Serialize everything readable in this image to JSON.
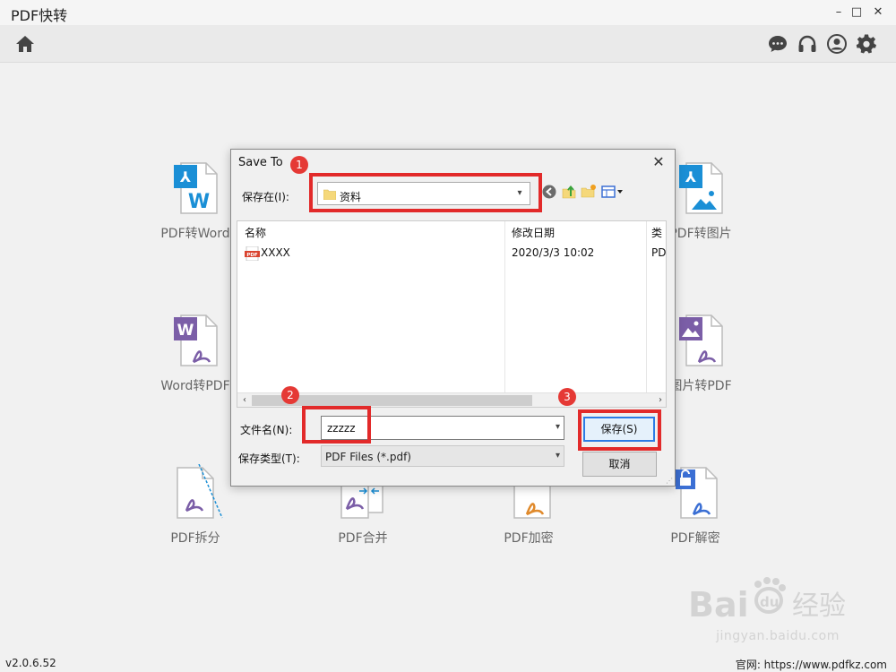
{
  "app": {
    "title": "PDF快转",
    "minimize": "–",
    "maximize": "□",
    "close": "✕"
  },
  "toolbar": {
    "home_icon": "home-icon",
    "icons": [
      "chat-icon",
      "headset-icon",
      "user-icon",
      "gear-icon"
    ]
  },
  "tools": [
    {
      "label": "PDF转Word"
    },
    {
      "label": "PDF转图片"
    },
    {
      "label": "Word转PDF"
    },
    {
      "label": "图片转PDF"
    },
    {
      "label": "PDF拆分"
    },
    {
      "label": "PDF合并"
    },
    {
      "label": "PDF加密"
    },
    {
      "label": "PDF解密"
    }
  ],
  "status": {
    "version": "v2.0.6.52",
    "site": "官网: https://www.pdfkz.com"
  },
  "watermark": {
    "brand": "Bai du 经验",
    "url": "jingyan.baidu.com"
  },
  "dialog": {
    "title": "Save To",
    "save_in_label": "保存在(I):",
    "folder": "资料",
    "columns": {
      "name": "名称",
      "date": "修改日期",
      "type": "类"
    },
    "files": [
      {
        "name": "XXXX",
        "date": "2020/3/3 10:02",
        "type": "PD"
      }
    ],
    "filename_label": "文件名(N):",
    "filename_value": "zzzzz",
    "filetype_label": "保存类型(T):",
    "filetype_value": "PDF Files (*.pdf)",
    "save_button": "保存(S)",
    "cancel_button": "取消",
    "close": "✕"
  },
  "annotations": [
    "1",
    "2",
    "3"
  ],
  "colors": {
    "accent_blue": "#1a8fd6",
    "word_purple": "#7b5ea7",
    "annotation_red": "#e22a2a",
    "pdf_red": "#d9432f"
  }
}
